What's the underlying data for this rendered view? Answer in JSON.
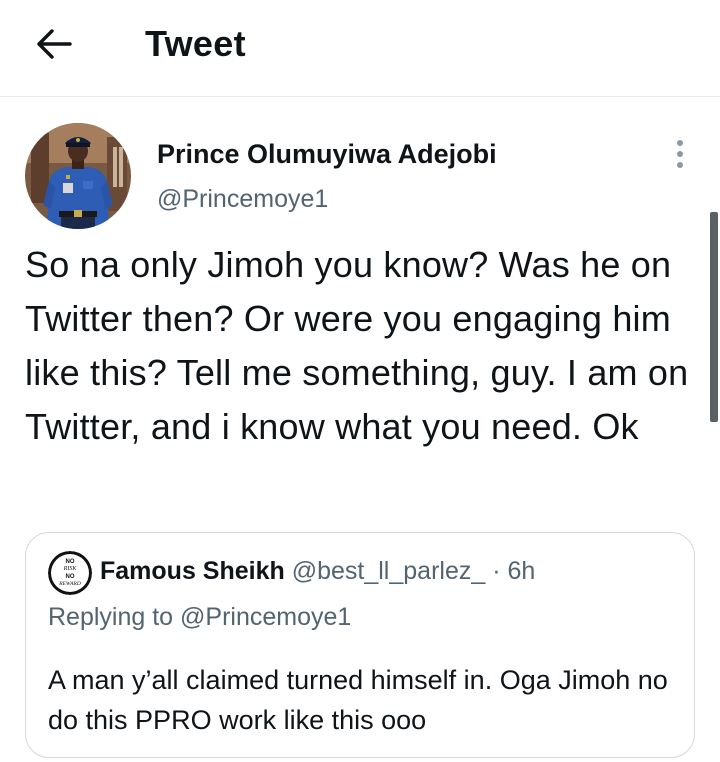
{
  "header": {
    "title": "Tweet",
    "back_icon": "arrow-left-icon"
  },
  "tweet": {
    "author_name": "Prince Olumuyiwa Adejobi",
    "author_handle": "@Princemoye1",
    "text": "So na only Jimoh you know? Was he on Twitter then? Or were you engaging him like this? Tell me something, guy. I am on Twitter, and i know what you need. Ok",
    "more_icon": "more-vertical-icon"
  },
  "quote": {
    "author_name": "Famous Sheikh",
    "author_handle": "@best_ll_parlez_",
    "separator": "·",
    "time": "6h",
    "replying_to": "Replying to @Princemoye1",
    "text": "A man y’all claimed turned himself in. Oga Jimoh no do this PPRO work like this ooo",
    "avatar_lettering": [
      "NO",
      "RISK",
      "NO",
      "REWARD"
    ]
  },
  "colors": {
    "text_primary": "#0f1419",
    "text_secondary": "#536471",
    "border": "#cfd9de",
    "uniform_blue": "#2d5db5"
  }
}
